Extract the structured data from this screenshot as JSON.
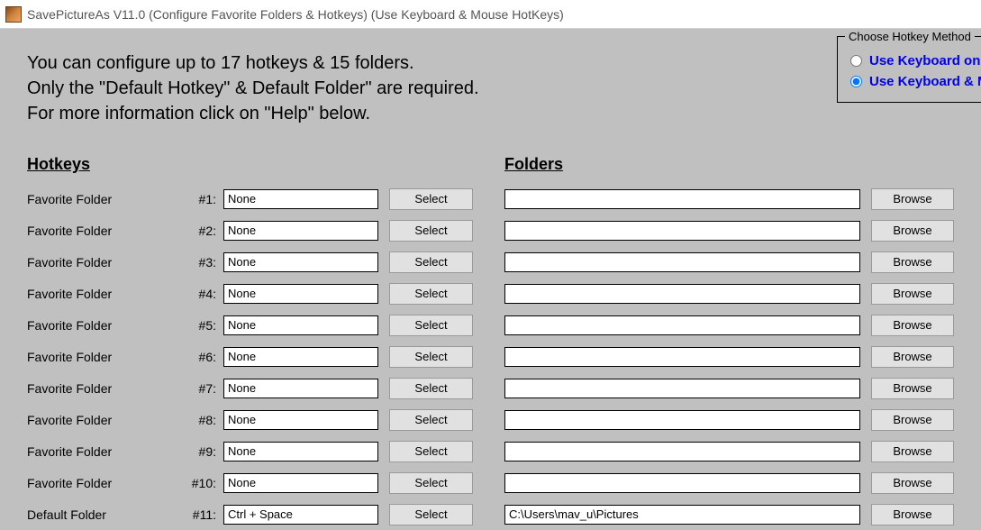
{
  "titlebar": {
    "text": "SavePictureAs V11.0 (Configure Favorite Folders & Hotkeys) (Use Keyboard & Mouse HotKeys)"
  },
  "intro": {
    "line1": "You can configure up to 17 hotkeys & 15 folders.",
    "line2": "Only the \"Default Hotkey\" & Default Folder\" are required.",
    "line3": "For more information click on \"Help\" below."
  },
  "hotkey_method": {
    "title": "Choose Hotkey Method",
    "option1": "Use Keyboard only hotkeys",
    "option2": "Use Keyboard & Mouse hotkeys",
    "selected": 2
  },
  "headers": {
    "hotkeys": "Hotkeys",
    "folders": "Folders"
  },
  "labels": {
    "select": "Select",
    "browse": "Browse",
    "favorite": "Favorite Folder",
    "default": "Default Folder"
  },
  "rows": [
    {
      "label": "Favorite Folder",
      "num": "#1:",
      "hotkey": "None",
      "folder": ""
    },
    {
      "label": "Favorite Folder",
      "num": "#2:",
      "hotkey": "None",
      "folder": ""
    },
    {
      "label": "Favorite Folder",
      "num": "#3:",
      "hotkey": "None",
      "folder": ""
    },
    {
      "label": "Favorite Folder",
      "num": "#4:",
      "hotkey": "None",
      "folder": ""
    },
    {
      "label": "Favorite Folder",
      "num": "#5:",
      "hotkey": "None",
      "folder": ""
    },
    {
      "label": "Favorite Folder",
      "num": "#6:",
      "hotkey": "None",
      "folder": ""
    },
    {
      "label": "Favorite Folder",
      "num": "#7:",
      "hotkey": "None",
      "folder": ""
    },
    {
      "label": "Favorite Folder",
      "num": "#8:",
      "hotkey": "None",
      "folder": ""
    },
    {
      "label": "Favorite Folder",
      "num": "#9:",
      "hotkey": "None",
      "folder": ""
    },
    {
      "label": "Favorite Folder",
      "num": "#10:",
      "hotkey": "None",
      "folder": ""
    },
    {
      "label": "Default Folder",
      "num": "#11:",
      "hotkey": "Ctrl + Space",
      "folder": "C:\\Users\\mav_u\\Pictures"
    }
  ]
}
